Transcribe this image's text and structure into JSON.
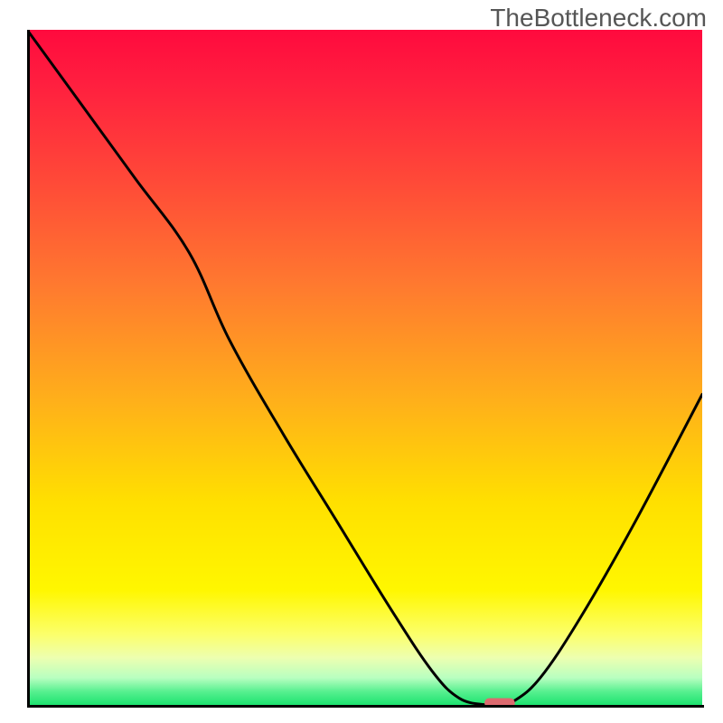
{
  "watermark": "TheBottleneck.com",
  "chart_data": {
    "type": "line",
    "title": "",
    "xlabel": "",
    "ylabel": "",
    "xlim": [
      0,
      100
    ],
    "ylim": [
      0,
      100
    ],
    "grid": false,
    "series": [
      {
        "name": "curve",
        "x": [
          0,
          8,
          16,
          24,
          30,
          38,
          46,
          54,
          60,
          64,
          68,
          70,
          72,
          76,
          82,
          90,
          100
        ],
        "values": [
          100,
          89,
          78,
          67,
          54,
          40,
          27,
          14,
          5,
          1,
          0,
          0,
          0.5,
          4,
          13,
          27,
          46
        ]
      }
    ],
    "marker": {
      "x": 70,
      "y": 0.3,
      "width_pct": 4.5,
      "height_pct": 1.4,
      "color": "#dd6a6f"
    },
    "gradient_stops": [
      {
        "pct": 0,
        "color": "#ff0a3e"
      },
      {
        "pct": 8,
        "color": "#ff1f3f"
      },
      {
        "pct": 22,
        "color": "#ff4838"
      },
      {
        "pct": 38,
        "color": "#ff7a2f"
      },
      {
        "pct": 55,
        "color": "#ffb01a"
      },
      {
        "pct": 70,
        "color": "#ffe000"
      },
      {
        "pct": 83,
        "color": "#fff700"
      },
      {
        "pct": 89.5,
        "color": "#fcff6a"
      },
      {
        "pct": 93,
        "color": "#edffb0"
      },
      {
        "pct": 96,
        "color": "#b8ffc0"
      },
      {
        "pct": 98,
        "color": "#58f090"
      },
      {
        "pct": 100,
        "color": "#1de36f"
      }
    ]
  }
}
